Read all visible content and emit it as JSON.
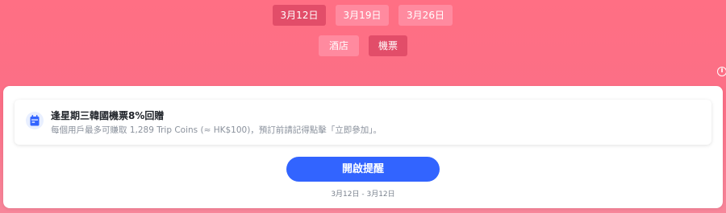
{
  "dates": [
    {
      "label": "3月12日",
      "active": true
    },
    {
      "label": "3月19日",
      "active": false
    },
    {
      "label": "3月26日",
      "active": false
    }
  ],
  "categories": [
    {
      "label": "酒店",
      "active": false
    },
    {
      "label": "機票",
      "active": true
    }
  ],
  "info_icon": {
    "glyph": "i",
    "name": "info-icon"
  },
  "promo": {
    "icon": "calendar-icon",
    "title": "逢星期三韓國機票8%回贈",
    "description": "每個用戶最多可賺取 1,289 Trip Coins (≈ HK$100)，預訂前請記得點擊「立即參加」。"
  },
  "cta": {
    "label": "開啟提醒"
  },
  "date_range": "3月12日 - 3月12日",
  "colors": {
    "background": "#ff6f84",
    "active_pill": "#e24d69",
    "inactive_pill": "#ff8a9f",
    "cta": "#3264ff",
    "icon_accent": "#3264ff"
  }
}
